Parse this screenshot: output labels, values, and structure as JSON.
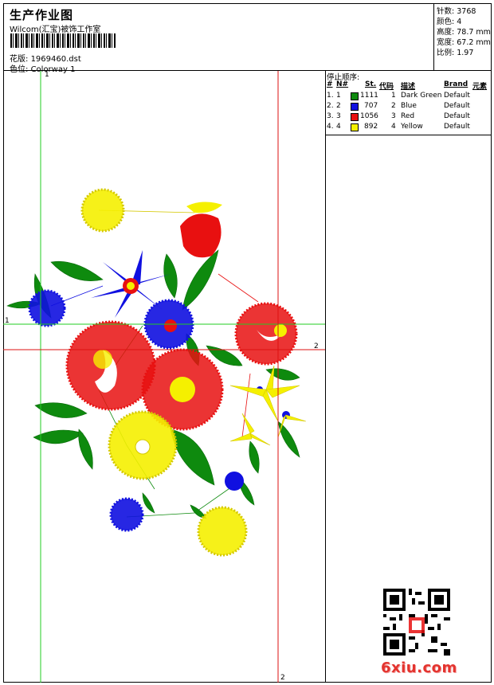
{
  "header": {
    "title": "生产作业图",
    "company": "Wilcom(汇宝)被饰工作室",
    "file_label": "花版:",
    "file_value": "1969460.dst",
    "colorway_label": "色位:",
    "colorway_value": "Colorway 1"
  },
  "stats": [
    {
      "label": "针数:",
      "value": "3768"
    },
    {
      "label": "颜色:",
      "value": "4"
    },
    {
      "label": "高度:",
      "value": "78.7 mm"
    },
    {
      "label": "宽度:",
      "value": "67.2 mm"
    },
    {
      "label": "比例:",
      "value": "1.97"
    }
  ],
  "stop_sequence": {
    "title": "停止顺序:",
    "headers": {
      "num": "#",
      "n": "N#",
      "st": "St.",
      "code": "代码",
      "desc": "描述",
      "brand": "Brand",
      "element": "元素"
    },
    "rows": [
      {
        "num": "1.",
        "n": "1",
        "color": "#0e8a0e",
        "st": "1111",
        "code": "1",
        "desc": "Dark Green",
        "brand": "Default"
      },
      {
        "num": "2.",
        "n": "2",
        "color": "#1010e0",
        "st": "707",
        "code": "2",
        "desc": "Blue",
        "brand": "Default"
      },
      {
        "num": "3.",
        "n": "3",
        "color": "#e81010",
        "st": "1056",
        "code": "3",
        "desc": "Red",
        "brand": "Default"
      },
      {
        "num": "4.",
        "n": "4",
        "color": "#f5f000",
        "st": "892",
        "code": "4",
        "desc": "Yellow",
        "brand": "Default"
      }
    ]
  },
  "guides": {
    "v1": "1",
    "h1": "1",
    "h2": "2",
    "v2": "2"
  },
  "watermark": "6xiu.com",
  "colors": {
    "green": "#0e8a0e",
    "blue": "#1010e0",
    "red": "#e81010",
    "yellow": "#f5f000",
    "guide_green": "#22cc22",
    "guide_red": "#dd1111"
  }
}
